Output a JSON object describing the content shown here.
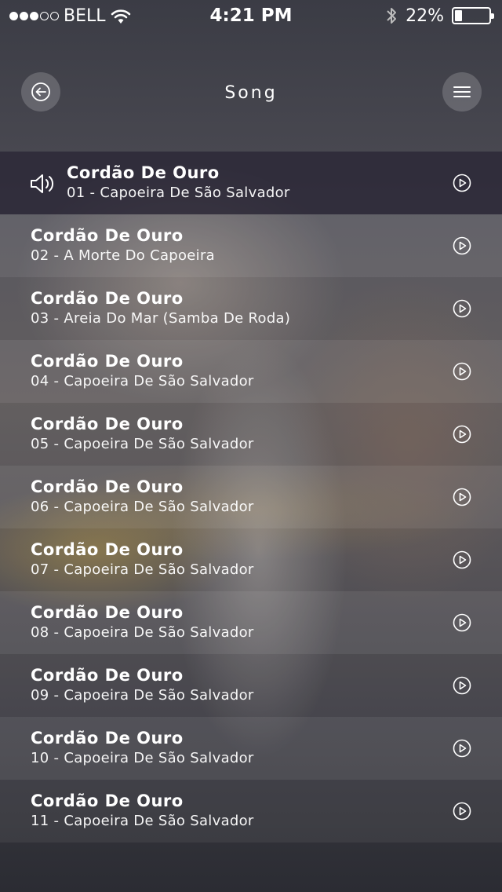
{
  "status_bar": {
    "carrier": "BELL",
    "signal_full": 3,
    "signal_total": 5,
    "time": "4:21 PM",
    "battery_percent": "22%",
    "battery_level": 0.22
  },
  "header": {
    "title": "Song",
    "back_icon": "back-arrow-circle-icon",
    "menu_icon": "hamburger-menu-icon"
  },
  "songs": [
    {
      "artist": "Cordão De Ouro",
      "track": "01 - Capoeira De São Salvador",
      "playing": true
    },
    {
      "artist": "Cordão De Ouro",
      "track": "02 - A Morte Do Capoeira",
      "playing": false
    },
    {
      "artist": "Cordão De Ouro",
      "track": "03 - Areia Do Mar (Samba De Roda)",
      "playing": false
    },
    {
      "artist": "Cordão De Ouro",
      "track": "04 - Capoeira De São Salvador",
      "playing": false
    },
    {
      "artist": "Cordão De Ouro",
      "track": "05 - Capoeira De São Salvador",
      "playing": false
    },
    {
      "artist": "Cordão De Ouro",
      "track": "06 - Capoeira De São Salvador",
      "playing": false
    },
    {
      "artist": "Cordão De Ouro",
      "track": "07 - Capoeira De São Salvador",
      "playing": false
    },
    {
      "artist": "Cordão De Ouro",
      "track": "08 - Capoeira De São Salvador",
      "playing": false
    },
    {
      "artist": "Cordão De Ouro",
      "track": "09 - Capoeira De São Salvador",
      "playing": false
    },
    {
      "artist": "Cordão De Ouro",
      "track": "10 - Capoeira De São Salvador",
      "playing": false
    },
    {
      "artist": "Cordão De Ouro",
      "track": "11 - Capoeira De São Salvador",
      "playing": false
    }
  ]
}
